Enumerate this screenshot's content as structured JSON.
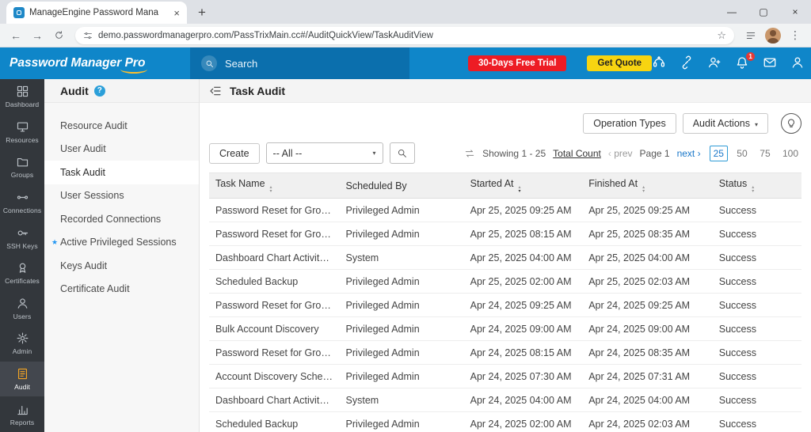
{
  "browser": {
    "tab_title": "ManageEngine Password Mana",
    "url": "demo.passwordmanagerpro.com/PassTrixMain.cc#/AuditQuickView/TaskAuditView"
  },
  "header": {
    "logo": "Password Manager Pro",
    "search_placeholder": "Search",
    "trial_button": "30-Days Free Trial",
    "quote_button": "Get Quote",
    "notification_count": "1"
  },
  "sidebar": {
    "items": [
      {
        "label": "Dashboard",
        "icon": "dashboard",
        "active": false
      },
      {
        "label": "Resources",
        "icon": "resources",
        "active": false
      },
      {
        "label": "Groups",
        "icon": "groups",
        "active": false
      },
      {
        "label": "Connections",
        "icon": "connections",
        "active": false
      },
      {
        "label": "SSH Keys",
        "icon": "ssh-keys",
        "active": false
      },
      {
        "label": "Certificates",
        "icon": "certificates",
        "active": false
      },
      {
        "label": "Users",
        "icon": "users",
        "active": false
      },
      {
        "label": "Admin",
        "icon": "admin",
        "active": false
      },
      {
        "label": "Audit",
        "icon": "audit",
        "active": true
      },
      {
        "label": "Reports",
        "icon": "reports",
        "active": false
      }
    ]
  },
  "audit_nav": {
    "title": "Audit",
    "items": [
      {
        "label": "Resource Audit",
        "active": false,
        "starred": false
      },
      {
        "label": "User Audit",
        "active": false,
        "starred": false
      },
      {
        "label": "Task Audit",
        "active": true,
        "starred": false
      },
      {
        "label": "User Sessions",
        "active": false,
        "starred": false
      },
      {
        "label": "Recorded Connections",
        "active": false,
        "starred": false
      },
      {
        "label": "Active Privileged Sessions",
        "active": false,
        "starred": true
      },
      {
        "label": "Keys Audit",
        "active": false,
        "starred": false
      },
      {
        "label": "Certificate Audit",
        "active": false,
        "starred": false
      }
    ]
  },
  "page": {
    "title": "Task Audit",
    "operation_types": "Operation Types",
    "audit_actions": "Audit Actions",
    "create": "Create",
    "filter_selected": "-- All --",
    "showing": "Showing 1 - 25",
    "total_count": "Total Count",
    "prev": "prev",
    "page": "Page 1",
    "next": "next",
    "page_sizes": [
      "25",
      "50",
      "75",
      "100"
    ],
    "active_page_size": "25"
  },
  "table": {
    "columns": [
      {
        "label": "Task Name",
        "sortable": true
      },
      {
        "label": "Scheduled By",
        "sortable": false
      },
      {
        "label": "Started At",
        "sortable": true,
        "sorted": "desc"
      },
      {
        "label": "Finished At",
        "sortable": true
      },
      {
        "label": "Status",
        "sortable": true
      }
    ],
    "rows": [
      [
        "Password Reset for Group - N...",
        "Privileged Admin",
        "Apr 25, 2025 09:25 AM",
        "Apr 25, 2025 09:25 AM",
        "Success"
      ],
      [
        "Password Reset for Group - De...",
        "Privileged Admin",
        "Apr 25, 2025 08:15 AM",
        "Apr 25, 2025 08:35 AM",
        "Success"
      ],
      [
        "Dashboard Chart Activity Sche...",
        "System",
        "Apr 25, 2025 04:00 AM",
        "Apr 25, 2025 04:00 AM",
        "Success"
      ],
      [
        "Scheduled Backup",
        "Privileged Admin",
        "Apr 25, 2025 02:00 AM",
        "Apr 25, 2025 02:03 AM",
        "Success"
      ],
      [
        "Password Reset for Group - N...",
        "Privileged Admin",
        "Apr 24, 2025 09:25 AM",
        "Apr 24, 2025 09:25 AM",
        "Success"
      ],
      [
        "Bulk Account Discovery",
        "Privileged Admin",
        "Apr 24, 2025 09:00 AM",
        "Apr 24, 2025 09:00 AM",
        "Success"
      ],
      [
        "Password Reset for Group - De...",
        "Privileged Admin",
        "Apr 24, 2025 08:15 AM",
        "Apr 24, 2025 08:35 AM",
        "Success"
      ],
      [
        "Account Discovery Schedule - ...",
        "Privileged Admin",
        "Apr 24, 2025 07:30 AM",
        "Apr 24, 2025 07:31 AM",
        "Success"
      ],
      [
        "Dashboard Chart Activity Sche...",
        "System",
        "Apr 24, 2025 04:00 AM",
        "Apr 24, 2025 04:00 AM",
        "Success"
      ],
      [
        "Scheduled Backup",
        "Privileged Admin",
        "Apr 24, 2025 02:00 AM",
        "Apr 24, 2025 02:03 AM",
        "Success"
      ]
    ]
  },
  "colors": {
    "header_blue": "#0f86c9",
    "search_blue": "#0b6fad",
    "trial_red": "#ed1c24",
    "quote_yellow": "#f7d411",
    "rail_dark": "#33373c",
    "active_icon_orange": "#f5a623",
    "link_blue": "#1a77c9",
    "active_page_border": "#2f9bd6"
  }
}
